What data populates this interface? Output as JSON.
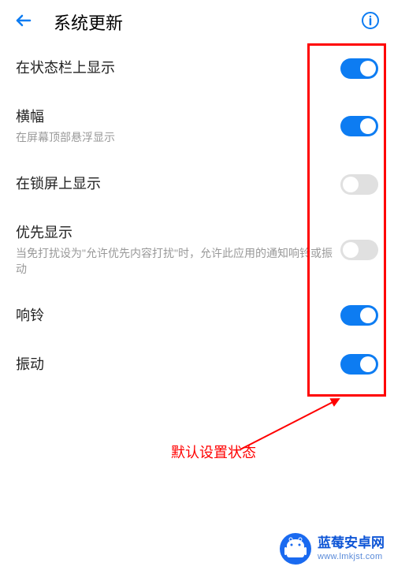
{
  "header": {
    "title": "系统更新"
  },
  "settings": [
    {
      "id": "status-bar",
      "label": "在状态栏上显示",
      "desc": "",
      "on": true
    },
    {
      "id": "banner",
      "label": "横幅",
      "desc": "在屏幕顶部悬浮显示",
      "on": true
    },
    {
      "id": "lockscreen",
      "label": "在锁屏上显示",
      "desc": "",
      "on": false
    },
    {
      "id": "priority",
      "label": "优先显示",
      "desc": "当免打扰设为\"允许优先内容打扰\"时，允许此应用的通知响铃或振动",
      "on": false
    },
    {
      "id": "ring",
      "label": "响铃",
      "desc": "",
      "on": true
    },
    {
      "id": "vibrate",
      "label": "振动",
      "desc": "",
      "on": true
    }
  ],
  "annotation": {
    "text": "默认设置状态"
  },
  "watermark": {
    "line1": "蓝莓安卓网",
    "line2": "www.lmkjst.com"
  }
}
